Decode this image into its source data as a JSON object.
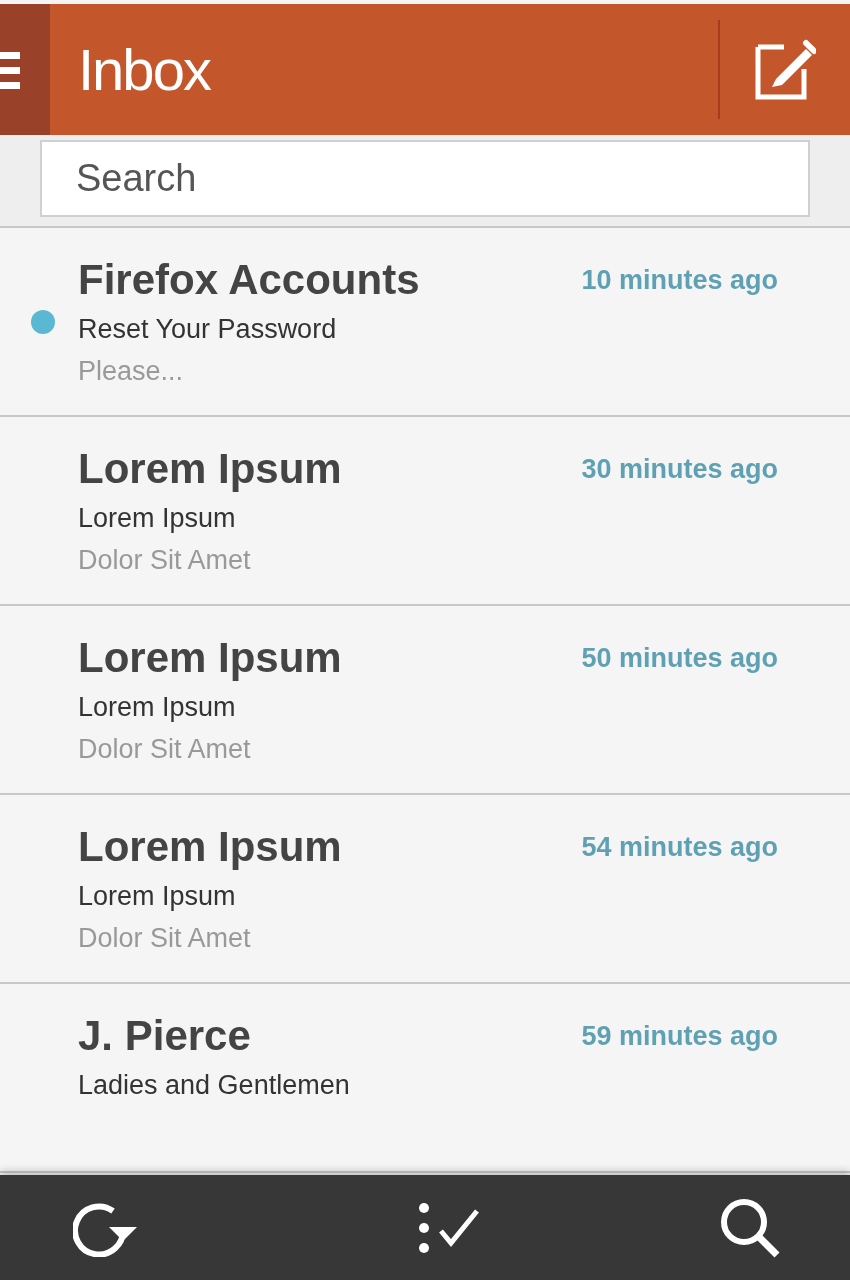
{
  "header": {
    "title": "Inbox"
  },
  "search": {
    "placeholder": "Search"
  },
  "messages": [
    {
      "sender": "Firefox Accounts",
      "time": "10 minutes ago",
      "subject": "Reset Your Password",
      "preview": "Please...",
      "unread": true
    },
    {
      "sender": "Lorem Ipsum",
      "time": "30 minutes ago",
      "subject": "Lorem Ipsum",
      "preview": "Dolor Sit Amet",
      "unread": false
    },
    {
      "sender": "Lorem Ipsum",
      "time": "50 minutes ago",
      "subject": "Lorem Ipsum",
      "preview": "Dolor Sit Amet",
      "unread": false
    },
    {
      "sender": "Lorem Ipsum",
      "time": "54 minutes ago",
      "subject": "Lorem Ipsum",
      "preview": "Dolor Sit Amet",
      "unread": false
    },
    {
      "sender": "J. Pierce",
      "time": "59 minutes ago",
      "subject": "Ladies and Gentlemen",
      "unread": false
    }
  ]
}
